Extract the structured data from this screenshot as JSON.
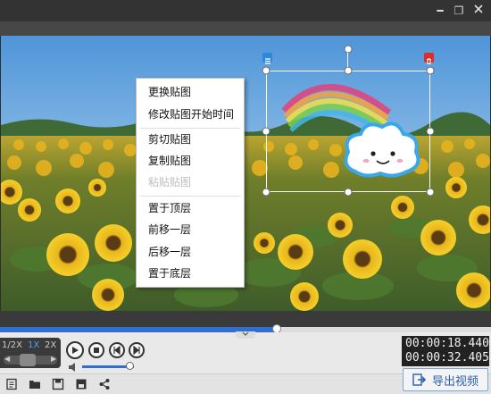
{
  "window": {
    "minimize_glyph": "━",
    "restore_glyph": "❐"
  },
  "speed": {
    "options": [
      "1/2X",
      "1X",
      "2X"
    ],
    "selected": "1X",
    "accent": "#4fa0ff"
  },
  "timeline": {
    "progress": 0.564
  },
  "playback": {
    "current_time": "00:00:18.440",
    "total_time": "00:00:32.405"
  },
  "volume": {
    "level": 0.92
  },
  "context_menu": {
    "groups": [
      [
        {
          "label": "更换贴图",
          "enabled": true
        },
        {
          "label": "修改贴图开始时间",
          "enabled": true
        }
      ],
      [
        {
          "label": "剪切贴图",
          "enabled": true
        },
        {
          "label": "复制贴图",
          "enabled": true
        },
        {
          "label": "粘贴贴图",
          "enabled": false
        }
      ],
      [
        {
          "label": "置于顶层",
          "enabled": true
        },
        {
          "label": "前移一层",
          "enabled": true
        },
        {
          "label": "后移一层",
          "enabled": true
        },
        {
          "label": "置于底层",
          "enabled": true
        }
      ]
    ]
  },
  "sticker": {
    "name": "rainbow-cloud",
    "handle_colors": {
      "menu": "#2e86de",
      "delete": "#e02b2b"
    }
  },
  "export": {
    "label": "导出视频",
    "accent": "#2a5fb0"
  },
  "toolbar_icons": [
    "new-project-icon",
    "open-folder-icon",
    "save-icon",
    "save-as-icon",
    "share-icon"
  ]
}
